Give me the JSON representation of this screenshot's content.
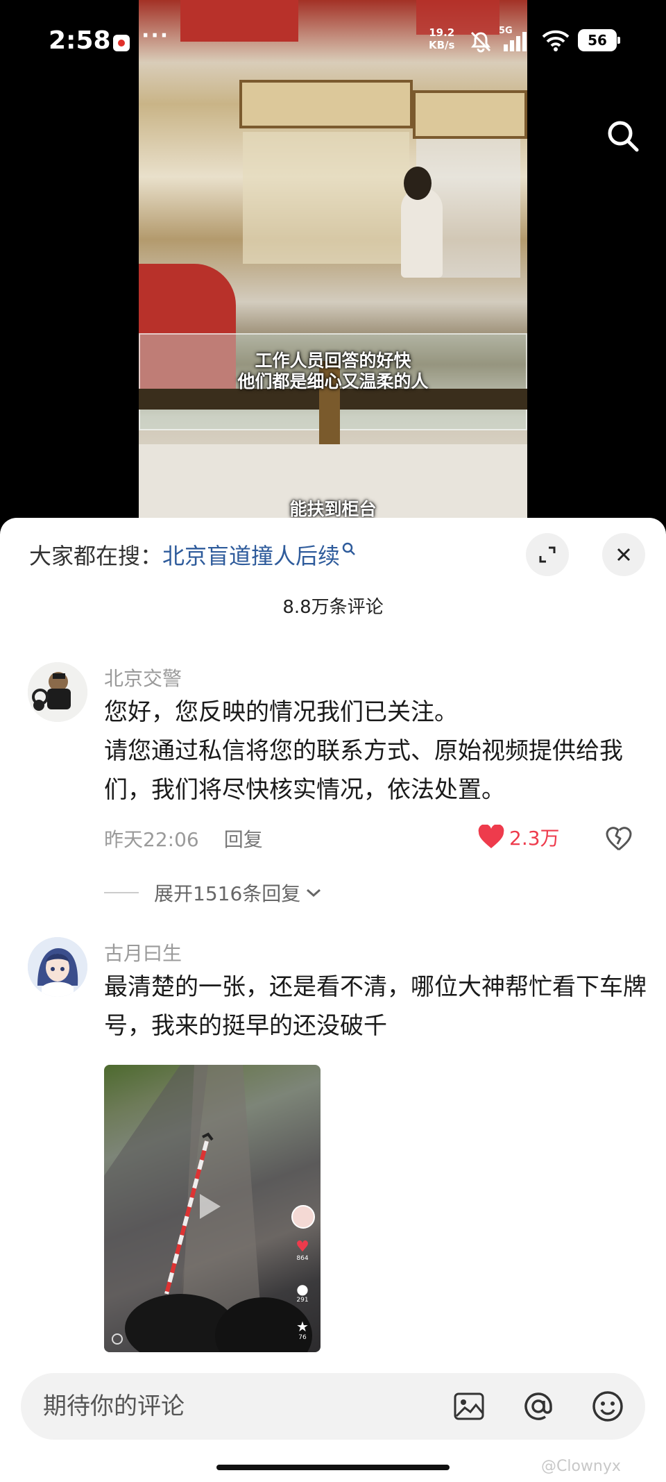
{
  "status_bar": {
    "time": "2:58",
    "more": "···",
    "net_speed_value": "19.2",
    "net_speed_unit": "KB/s",
    "network": "5G",
    "battery": "56"
  },
  "video": {
    "caption_line1": "工作人员回答的好快",
    "caption_line2": "他们都是细心又温柔的人",
    "caption_bottom": "能扶到柜台"
  },
  "sheet": {
    "trending_label": "大家都在搜：",
    "trending_query": "北京盲道撞人后续",
    "comment_count": "8.8万条评论"
  },
  "comments": [
    {
      "username": "北京交警",
      "text": "您好，您反映的情况我们已关注。\n请您通过私信将您的联系方式、原始视频提供给我们，我们将尽快核实情况，依法处置。",
      "time": "昨天22:06",
      "reply_label": "回复",
      "likes": "2.3万",
      "expand_label": "展开1516条回复"
    },
    {
      "username": "古月曰生",
      "text": "最清楚的一张，还是看不清，哪位大神帮忙看下车牌号，我来的挺早的还没破千",
      "image": {
        "likes": "864",
        "comments": "291",
        "favorites": "76"
      }
    }
  ],
  "input_bar": {
    "placeholder": "期待你的评论"
  },
  "watermark": "@Clownyx",
  "colors": {
    "like_red": "#ee3b4c",
    "link_blue": "#2e5b9b"
  }
}
